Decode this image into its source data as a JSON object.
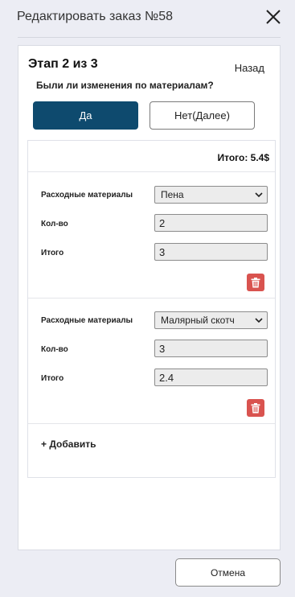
{
  "dialog": {
    "title": "Редактировать заказ №58"
  },
  "step": {
    "title": "Этап 2 из 3",
    "back_label": "Назад",
    "question": "Были ли изменения по материалам?",
    "yes_label": "Да",
    "no_label": "Нет(Далее)"
  },
  "materials": {
    "total_label": "Итого: 5.4$",
    "items": [
      {
        "material_label": "Расходные материалы",
        "material_value": "Пена",
        "qty_label": "Кол-во",
        "qty_value": "2",
        "total_label": "Итого",
        "total_value": "3"
      },
      {
        "material_label": "Расходные материалы",
        "material_value": "Малярный скотч",
        "qty_label": "Кол-во",
        "qty_value": "3",
        "total_label": "Итого",
        "total_value": "2.4"
      }
    ],
    "add_label": "+ Добавить"
  },
  "footer": {
    "cancel_label": "Отмена"
  },
  "colors": {
    "primary": "#0e4a6e",
    "danger": "#d9534f",
    "background": "#ecedf4"
  }
}
